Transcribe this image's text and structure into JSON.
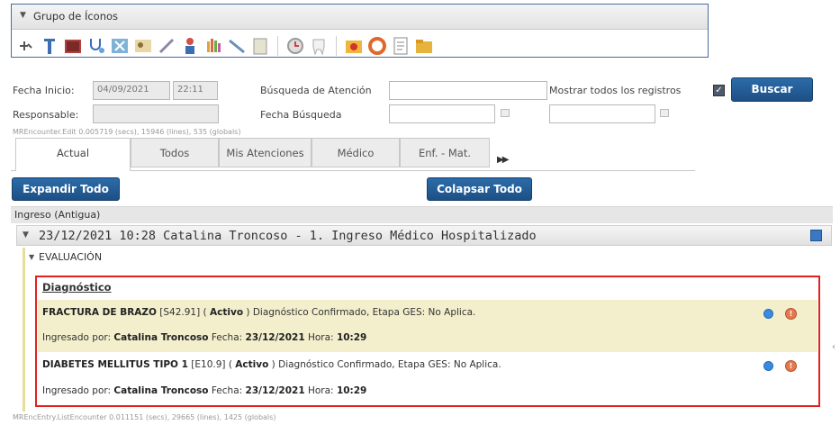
{
  "group": {
    "title": "Grupo de Íconos"
  },
  "toolbar_icons": [
    "pin-icon",
    "test-tube-icon",
    "book-icon",
    "stethoscope-icon",
    "xray-icon",
    "id-card-icon",
    "syringe-icon",
    "person-icon",
    "hand-icon",
    "scalpel-icon",
    "document-icon",
    "clock-icon",
    "tooth-icon",
    "folder-red-icon",
    "lifebuoy-icon",
    "form-icon",
    "folder-icon"
  ],
  "filters": {
    "fecha_inicio_label": "Fecha Inicio:",
    "fecha_inicio_value": "04/09/2021",
    "hora_inicio_value": "22:11",
    "busqueda_atencion_label": "Búsqueda de Atención",
    "mostrar_todos_label": "Mostrar todos los registros",
    "buscar_label": "Buscar",
    "responsable_label": "Responsable:",
    "fecha_busqueda_label": "Fecha Búsqueda"
  },
  "meta_top": "MREncounter.Edit  0.005719 (secs),  15946 (lines),  535 (globals)",
  "tabs": [
    "Actual",
    "Todos",
    "Mis Atenciones",
    "Médico",
    "Enf. - Mat."
  ],
  "buttons": {
    "expandir": "Expandir Todo",
    "colapsar": "Colapsar Todo"
  },
  "section": "Ingreso (Antigua)",
  "encounter": {
    "title": "23/12/2021 10:28 Catalina Troncoso - 1. Ingreso Médico Hospitalizado",
    "evaluacion": "EVALUACIÓN",
    "diagnostico_title": "Diagnóstico",
    "diagnoses": [
      {
        "name": "FRACTURA DE BRAZO",
        "code": "[S42.91]",
        "status": "Activo",
        "detail": "Diagnóstico Confirmado, Etapa GES: No Aplica.",
        "ingresado_por_label": "Ingresado por:",
        "author": "Catalina Troncoso",
        "fecha_label": "Fecha:",
        "fecha": "23/12/2021",
        "hora_label": "Hora:",
        "hora": "10:29"
      },
      {
        "name": "DIABETES MELLITUS TIPO 1",
        "code": "[E10.9]",
        "status": "Activo",
        "detail": "Diagnóstico Confirmado, Etapa GES: No Aplica.",
        "ingresado_por_label": "Ingresado por:",
        "author": "Catalina Troncoso",
        "fecha_label": "Fecha:",
        "fecha": "23/12/2021",
        "hora_label": "Hora:",
        "hora": "10:29"
      }
    ]
  },
  "meta_bottom": "MREncEntry.ListEncounter  0.011151 (secs),  29665 (lines),  1425 (globals)",
  "colors": {
    "accent_blue": "#1d4f86",
    "highlight_red": "#e32020",
    "row_yellow": "#f3efcc"
  }
}
